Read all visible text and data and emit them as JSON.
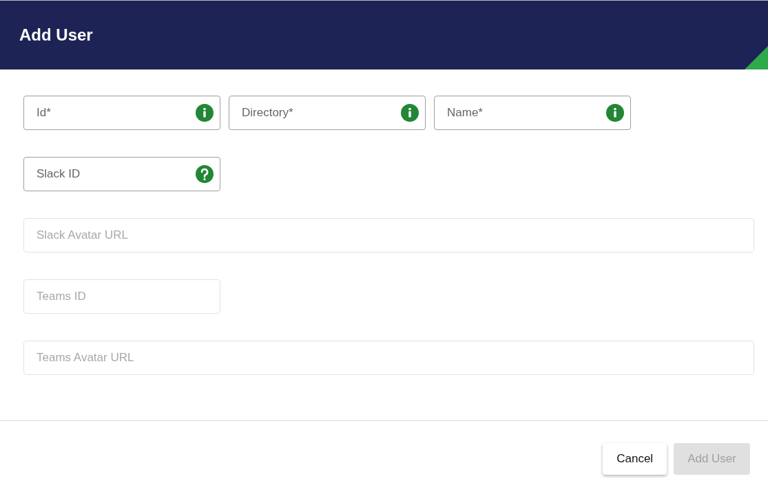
{
  "dialog": {
    "title": "Add User"
  },
  "rows": [
    {
      "fields": [
        {
          "placeholder": "Id*",
          "kind": "info",
          "disabled": false
        },
        {
          "placeholder": "Directory*",
          "kind": "info",
          "disabled": false
        },
        {
          "placeholder": "Name*",
          "kind": "info",
          "disabled": false
        }
      ]
    },
    {
      "fields": [
        {
          "placeholder": "Slack ID",
          "kind": "help",
          "disabled": false
        }
      ]
    },
    {
      "fields": [
        {
          "placeholder": "Slack Avatar URL",
          "kind": "wide",
          "disabled": true
        }
      ]
    },
    {
      "fields": [
        {
          "placeholder": "Teams ID",
          "kind": "plain",
          "disabled": true
        }
      ]
    },
    {
      "fields": [
        {
          "placeholder": "Teams Avatar URL",
          "kind": "wide",
          "disabled": true
        }
      ]
    }
  ],
  "buttons": [
    {
      "label": "Cancel",
      "disabled": false
    },
    {
      "label": "Add User",
      "disabled": true
    }
  ]
}
